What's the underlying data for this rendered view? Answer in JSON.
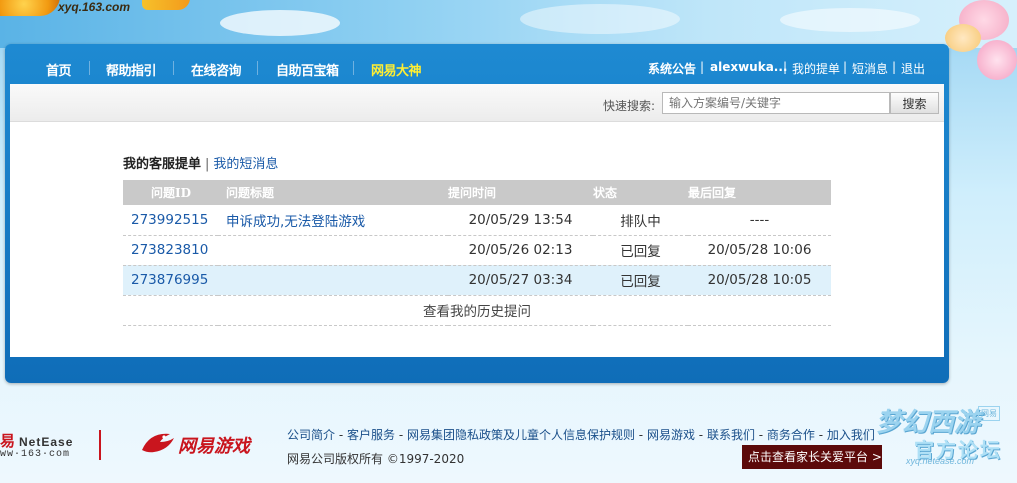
{
  "header": {
    "site_url": "xyq.163.com"
  },
  "nav": {
    "items": [
      "首页",
      "帮助指引",
      "在线咨询",
      "自助百宝箱",
      "网易大神"
    ],
    "active_index": 4,
    "right": {
      "notice": "系统公告",
      "user": "alexwuka...",
      "my_tickets": "我的提单",
      "messages": "短消息",
      "logout": "退出",
      "sep": "|"
    }
  },
  "search": {
    "label": "快速搜索:",
    "placeholder": "输入方案编号/关键字",
    "button": "搜索"
  },
  "tabs": {
    "active": "我的客服提单",
    "sep": "|",
    "other": "我的短消息"
  },
  "table": {
    "headers": [
      "问题ID",
      "问题标题",
      "提问时间",
      "状态",
      "最后回复"
    ],
    "rows": [
      {
        "id": "273992515",
        "title": "申诉成功,无法登陆游戏",
        "time": "20/05/29 13:54",
        "status": "排队中",
        "last": "----"
      },
      {
        "id": "273823810",
        "title": "",
        "time": "20/05/26 02:13",
        "status": "已回复",
        "last": "20/05/28 10:06"
      },
      {
        "id": "273876995",
        "title": "",
        "time": "20/05/27 03:34",
        "status": "已回复",
        "last": "20/05/28 10:05"
      }
    ],
    "history_link": "查看我的历史提问"
  },
  "footer": {
    "logo1_cn": "易",
    "logo1_en": "NetEase",
    "logo1_url": "ww·163·com",
    "logo2": "网易游戏",
    "links": [
      "公司简介",
      "客户服务",
      "网易集团隐私政策及儿童个人信息保护规则",
      "网易游戏",
      "联系我们",
      "商务合作",
      "加入我们"
    ],
    "link_sep": " - ",
    "copyright": "网易公司版权所有 ©1997-2020",
    "care_button": "点击查看家长关爱平台 >",
    "brand_title": "梦幻西游",
    "brand_sub": "官方论坛",
    "brand_url": "xyq.netease.com",
    "brand_badge": "网易"
  }
}
